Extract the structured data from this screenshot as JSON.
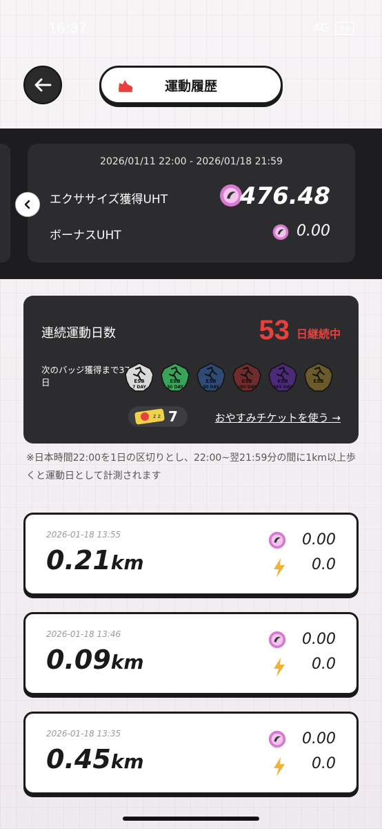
{
  "status_bar": {
    "time": "16:37",
    "network": "4G",
    "battery": "56"
  },
  "header": {
    "title": "運動履歴"
  },
  "summary": {
    "period": "2026/01/11 22:00 - 2026/01/18 21:59",
    "exercise_label": "エクササイズ獲得UHT",
    "exercise_value": "476.48",
    "bonus_label": "ボーナスUHT",
    "bonus_value": "0.00"
  },
  "streak": {
    "label": "連続運動日数",
    "days": "53",
    "suffix": "日継続中",
    "badge_note": "次のバッジ獲得まで37日",
    "badges": [
      {
        "brand": "ESB",
        "label": "7 DAY",
        "color": "#d9d9d9"
      },
      {
        "brand": "ESB",
        "label": "30 DAY",
        "color": "#3aa35a"
      },
      {
        "brand": "ESB",
        "label": "90 DAY",
        "color": "#2f4a75"
      },
      {
        "brand": "ESB",
        "label": "180 DAY",
        "color": "#6e2c2c"
      },
      {
        "brand": "ESB",
        "label": "365 DAY",
        "color": "#4b2a7a"
      },
      {
        "brand": "ESB",
        "label": "",
        "color": "#6b5a2c"
      }
    ],
    "ticket_count": "7",
    "ticket_link": "おやすみチケットを使う →"
  },
  "footnote": "※日本時間22:00を1日の区切りとし、22:00~翌21:59分の間に1km以上歩くと運動日として計測されます",
  "runs": [
    {
      "datetime": "2026-01-18 13:55",
      "distance": "0.21",
      "unit": "km",
      "uht": "0.00",
      "energy": "0.0"
    },
    {
      "datetime": "2026-01-18 13:46",
      "distance": "0.09",
      "unit": "km",
      "uht": "0.00",
      "energy": "0.0"
    },
    {
      "datetime": "2026-01-18 13:35",
      "distance": "0.45",
      "unit": "km",
      "uht": "0.00",
      "energy": "0.0"
    }
  ],
  "colors": {
    "accent_red": "#e8413d",
    "coin_pink": "#d77bd0",
    "bolt_yellow": "#f0b43a",
    "dark_panel": "#2c2c2e"
  }
}
